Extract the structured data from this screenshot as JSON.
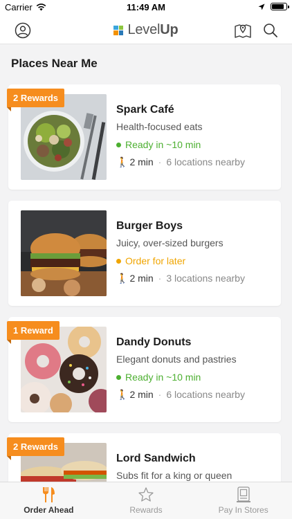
{
  "status_bar": {
    "carrier": "Carrier",
    "time": "11:49 AM",
    "battery_level": 0.92
  },
  "header": {
    "logo_text_light": "Level",
    "logo_text_bold": "Up",
    "icons": [
      "user-icon",
      "map-pin-icon",
      "search-icon"
    ]
  },
  "main": {
    "title": "Places Near Me",
    "places": [
      {
        "badge": "2 Rewards",
        "name": "Spark Café",
        "tagline": "Health-focused eats",
        "order_status": "Ready in ~10 min",
        "order_color": "#4caf30",
        "walk_time": "2 min",
        "locations": "6 locations nearby",
        "image": "salad bowl"
      },
      {
        "badge": "",
        "name": "Burger Boys",
        "tagline": "Juicy, over-sized burgers",
        "order_status": "Order for later",
        "order_color": "#f0a500",
        "walk_time": "2 min",
        "locations": "3 locations nearby",
        "image": "burgers"
      },
      {
        "badge": "1 Reward",
        "name": "Dandy Donuts",
        "tagline": "Elegant donuts and pastries",
        "order_status": "Ready in ~10 min",
        "order_color": "#4caf30",
        "walk_time": "2 min",
        "locations": "6 locations nearby",
        "image": "donuts"
      },
      {
        "badge": "2 Rewards",
        "name": "Lord Sandwich",
        "tagline": "Subs fit for a king or queen",
        "order_status": "",
        "order_color": "#4caf30",
        "walk_time": "",
        "locations": "",
        "image": "sandwich"
      }
    ]
  },
  "tabs": [
    {
      "label": "Order Ahead",
      "icon": "fork-knife-icon",
      "active": true
    },
    {
      "label": "Rewards",
      "icon": "star-icon",
      "active": false
    },
    {
      "label": "Pay In Stores",
      "icon": "qr-terminal-icon",
      "active": false
    }
  ],
  "colors": {
    "accent": "#f68d1e",
    "ready": "#4caf30",
    "later": "#f0a500",
    "tab_active": "#333333",
    "tab_inactive": "#999999"
  }
}
